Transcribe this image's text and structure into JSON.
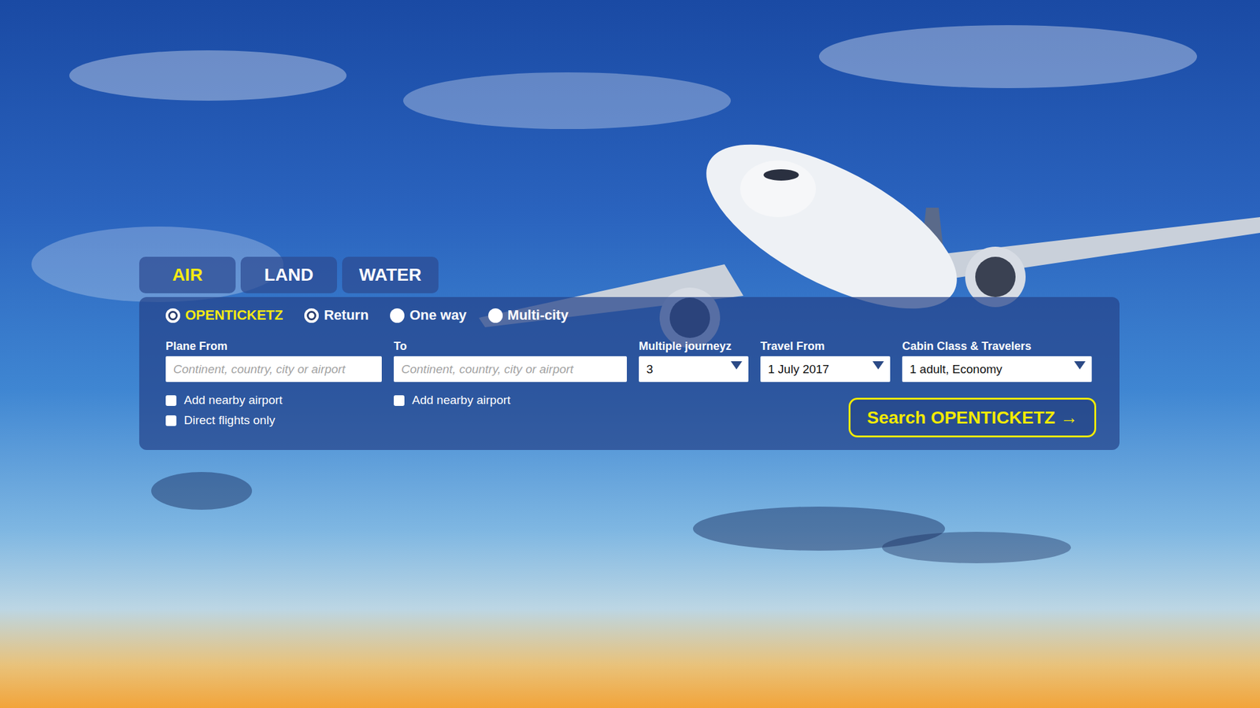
{
  "tabs": [
    {
      "label": "AIR",
      "selected": true
    },
    {
      "label": "LAND",
      "selected": false
    },
    {
      "label": "WATER",
      "selected": false
    }
  ],
  "trip_types": [
    {
      "label": "OPENTICKETZ",
      "selected": true,
      "color": "#f5ea14"
    },
    {
      "label": "Return",
      "selected": true,
      "color": "#ffffff"
    },
    {
      "label": "One way",
      "selected": false,
      "color": "#ffffff"
    },
    {
      "label": "Multi-city",
      "selected": false,
      "color": "#ffffff"
    }
  ],
  "fields": [
    {
      "label": "Plane From",
      "kind": "text",
      "placeholder": "Continent, country, city or airport",
      "checkboxes": [
        {
          "label": "Add nearby airport",
          "checked": false
        },
        {
          "label": "Direct flights only",
          "checked": false
        }
      ]
    },
    {
      "label": "To",
      "kind": "text",
      "placeholder": "Continent, country, city or airport",
      "checkboxes": [
        {
          "label": "Add nearby airport",
          "checked": false
        }
      ]
    },
    {
      "label": "Multiple journeyz",
      "kind": "select",
      "value": "3"
    },
    {
      "label": "Travel From",
      "kind": "select",
      "value": "1 July 2017"
    },
    {
      "label": "Cabin Class & Travelers",
      "kind": "select",
      "value": "1 adult, Economy"
    }
  ],
  "search_button": {
    "label": "Search OPENTICKETZ →"
  }
}
